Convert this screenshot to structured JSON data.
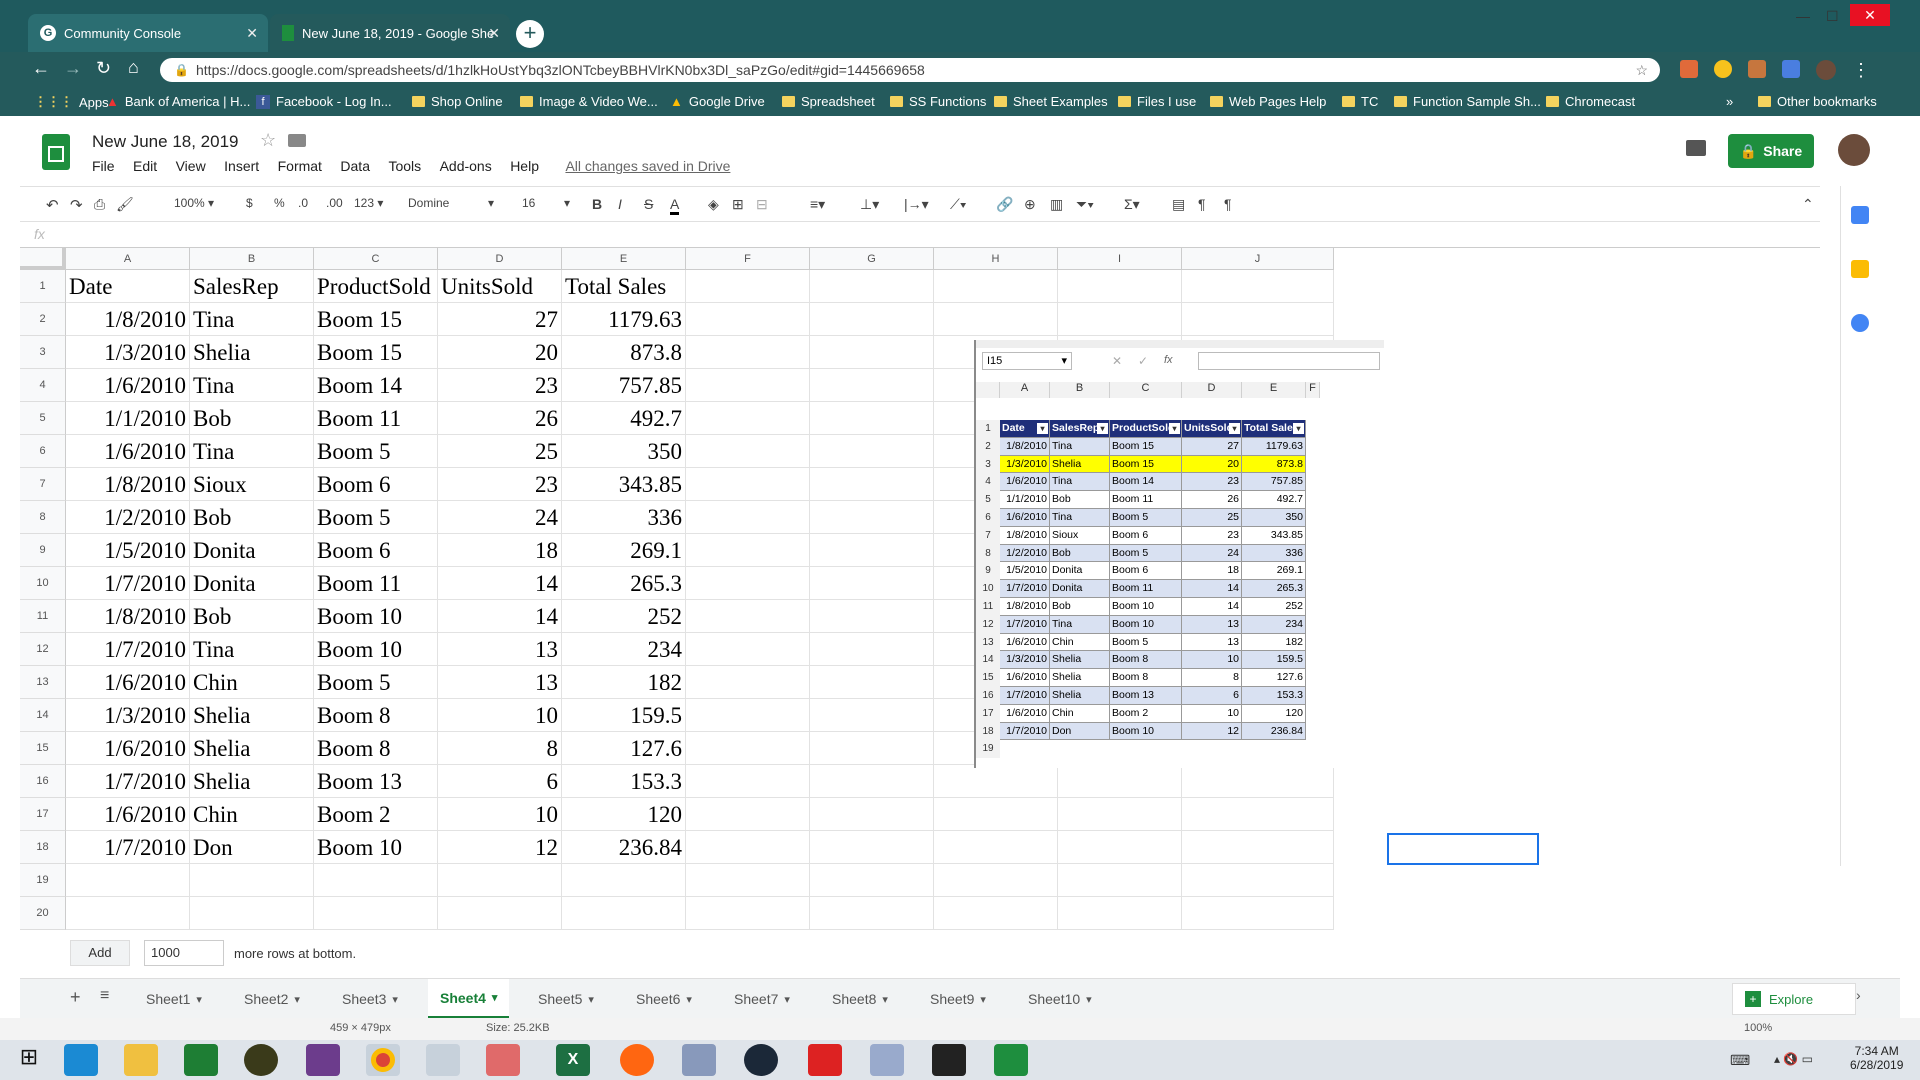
{
  "browser": {
    "tabs": [
      {
        "label": "Community Console",
        "active": false
      },
      {
        "label": "New June 18, 2019 - Google She",
        "active": true
      }
    ],
    "url": "https://docs.google.com/spreadsheets/d/1hzlkHoUstYbq3zlONTcbeyBBHVlrKN0bx3Dl_saPzGo/edit#gid=1445669658",
    "bookmarks": [
      "Apps",
      "Bank of America | H...",
      "Facebook - Log In...",
      "Shop Online",
      "Image & Video We...",
      "Google Drive",
      "Spreadsheet",
      "SS Functions",
      "Sheet Examples",
      "Files I use",
      "Web Pages Help",
      "TC",
      "Function Sample Sh...",
      "Chromecast"
    ],
    "other_bookmarks": "Other bookmarks",
    "more": "»"
  },
  "doc": {
    "title": "New June 18, 2019",
    "menu": [
      "File",
      "Edit",
      "View",
      "Insert",
      "Format",
      "Data",
      "Tools",
      "Add-ons",
      "Help"
    ],
    "saved_status": "All changes saved in Drive",
    "share_label": "Share"
  },
  "toolbar": {
    "zoom": "100%",
    "currency": "$",
    "percent": "%",
    "dec_less": ".0",
    "dec_more": ".00",
    "format_more": "123",
    "font": "Domine",
    "font_size": "16",
    "bold": "B",
    "italic": "I",
    "strike": "S",
    "text_color": "A",
    "fx": "fx"
  },
  "grid": {
    "columns": [
      "A",
      "B",
      "C",
      "D",
      "E",
      "F",
      "G",
      "H",
      "I",
      "J"
    ],
    "rows": [
      [
        "Date",
        "SalesRep",
        "ProductSold",
        "UnitsSold",
        "Total Sales"
      ],
      [
        "1/8/2010",
        "Tina",
        "Boom 15",
        "27",
        "1179.63"
      ],
      [
        "1/3/2010",
        "Shelia",
        "Boom 15",
        "20",
        "873.8"
      ],
      [
        "1/6/2010",
        "Tina",
        "Boom 14",
        "23",
        "757.85"
      ],
      [
        "1/1/2010",
        "Bob",
        "Boom 11",
        "26",
        "492.7"
      ],
      [
        "1/6/2010",
        "Tina",
        "Boom 5",
        "25",
        "350"
      ],
      [
        "1/8/2010",
        "Sioux",
        "Boom 6",
        "23",
        "343.85"
      ],
      [
        "1/2/2010",
        "Bob",
        "Boom 5",
        "24",
        "336"
      ],
      [
        "1/5/2010",
        "Donita",
        "Boom 6",
        "18",
        "269.1"
      ],
      [
        "1/7/2010",
        "Donita",
        "Boom 11",
        "14",
        "265.3"
      ],
      [
        "1/8/2010",
        "Bob",
        "Boom 10",
        "14",
        "252"
      ],
      [
        "1/7/2010",
        "Tina",
        "Boom 10",
        "13",
        "234"
      ],
      [
        "1/6/2010",
        "Chin",
        "Boom 5",
        "13",
        "182"
      ],
      [
        "1/3/2010",
        "Shelia",
        "Boom 8",
        "10",
        "159.5"
      ],
      [
        "1/6/2010",
        "Shelia",
        "Boom 8",
        "8",
        "127.6"
      ],
      [
        "1/7/2010",
        "Shelia",
        "Boom 13",
        "6",
        "153.3"
      ],
      [
        "1/6/2010",
        "Chin",
        "Boom 2",
        "10",
        "120"
      ],
      [
        "1/7/2010",
        "Don",
        "Boom 10",
        "12",
        "236.84"
      ]
    ],
    "row_numbers": [
      "1",
      "2",
      "3",
      "4",
      "5",
      "6",
      "7",
      "8",
      "9",
      "10",
      "11",
      "12",
      "13",
      "14",
      "15",
      "16",
      "17",
      "18",
      "19",
      "20"
    ]
  },
  "excel_image": {
    "name_box": "I15",
    "fx": "fx",
    "columns": [
      "A",
      "B",
      "C",
      "D",
      "E",
      "F"
    ],
    "headers": [
      "Date",
      "SalesRep",
      "ProductSold",
      "UnitsSold",
      "Total Sales"
    ],
    "highlight_row": 2,
    "row_numbers": [
      "1",
      "2",
      "3",
      "4",
      "5",
      "6",
      "7",
      "8",
      "9",
      "10",
      "11",
      "12",
      "13",
      "14",
      "15",
      "16",
      "17",
      "18",
      "19"
    ]
  },
  "bottom": {
    "add_label": "Add",
    "rows_value": "1000",
    "rows_suffix": "more rows at bottom.",
    "sheets": [
      "Sheet1",
      "Sheet2",
      "Sheet3",
      "Sheet4",
      "Sheet5",
      "Sheet6",
      "Sheet7",
      "Sheet8",
      "Sheet9",
      "Sheet10"
    ],
    "active_sheet": "Sheet4",
    "explore_label": "Explore",
    "status_dims": "459 × 479px",
    "status_size": "Size: 25.2KB",
    "status_zoom": "100%"
  },
  "taskbar": {
    "time": "7:34 AM",
    "date": "6/28/2019"
  },
  "colors": {
    "chrome_bg": "#245a5c",
    "sheets_green": "#1e8e3e",
    "excel_header": "#1f2f7a",
    "excel_band": "#d9e1f2",
    "highlight": "#ffff00",
    "active_sheet": "#188038"
  }
}
